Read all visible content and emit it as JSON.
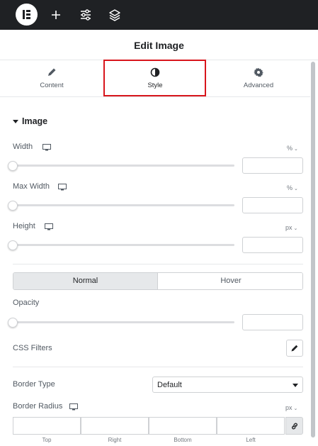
{
  "toolbar": {
    "icons": [
      "elementor-logo-icon",
      "add-icon",
      "settings-sliders-icon",
      "layers-icon"
    ]
  },
  "header": {
    "title": "Edit Image"
  },
  "tabs": [
    {
      "label": "Content",
      "icon": "pencil-icon"
    },
    {
      "label": "Style",
      "icon": "half-circle-icon",
      "active": true
    },
    {
      "label": "Advanced",
      "icon": "gear-icon"
    }
  ],
  "section": {
    "title": "Image"
  },
  "controls": {
    "width": {
      "label": "Width",
      "unit": "%",
      "value": "",
      "slider": 0
    },
    "max_width": {
      "label": "Max Width",
      "unit": "%",
      "value": "",
      "slider": 0
    },
    "height": {
      "label": "Height",
      "unit": "px",
      "value": "",
      "slider": 0
    },
    "state_tabs": {
      "normal": "Normal",
      "hover": "Hover",
      "selected": "Normal"
    },
    "opacity": {
      "label": "Opacity",
      "value": "",
      "slider": 0
    },
    "css_filters": {
      "label": "CSS Filters"
    },
    "border_type": {
      "label": "Border Type",
      "value": "Default"
    },
    "border_radius": {
      "label": "Border Radius",
      "unit": "px",
      "sides": [
        "Top",
        "Right",
        "Bottom",
        "Left"
      ]
    }
  },
  "colors": {
    "toolbar_bg": "#1f2124",
    "highlight": "#d8151c",
    "active_state_bg": "#e6e8ea"
  }
}
